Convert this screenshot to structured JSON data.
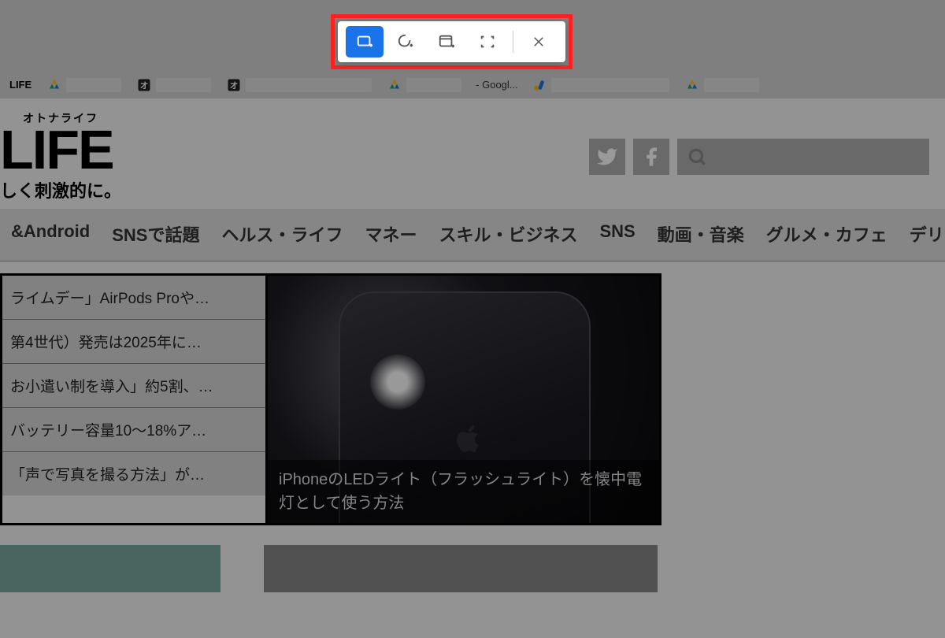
{
  "bookmarks": [
    {
      "label": "LIFE",
      "icon": "text"
    },
    {
      "label": "",
      "icon": "drive"
    },
    {
      "label": "",
      "icon": "square-o"
    },
    {
      "label": "",
      "icon": "square-o"
    },
    {
      "label": "",
      "icon": "drive"
    },
    {
      "label": "- Googl...",
      "icon": "none",
      "textOnly": true
    },
    {
      "label": "",
      "icon": "ads"
    },
    {
      "label": "",
      "icon": "drive"
    }
  ],
  "logo": {
    "furigana": "オトナライフ",
    "text": "LIFE",
    "tagline": "しく刺激的に。"
  },
  "nav": [
    "&Android",
    "SNSで話題",
    "ヘルス・ライフ",
    "マネー",
    "スキル・ビジネス",
    "SNS",
    "動画・音楽",
    "グルメ・カフェ",
    "デリ"
  ],
  "articles": [
    "ライムデー」AirPods Proや…",
    "第4世代）発売は2025年に…",
    "お小遣い制を導入」約5割、…",
    "バッテリー容量10～18%ア…",
    "「声で写真を撮る方法」が…"
  ],
  "feature_caption": "iPhoneのLEDライト（フラッシュライト）を懐中電灯として使う方法",
  "screenshot_toolbar": {
    "buttons": [
      {
        "name": "rectangle-select",
        "active": true
      },
      {
        "name": "freeform-select",
        "active": false
      },
      {
        "name": "window-select",
        "active": false
      },
      {
        "name": "fullscreen-select",
        "active": false
      }
    ],
    "close": "close"
  }
}
